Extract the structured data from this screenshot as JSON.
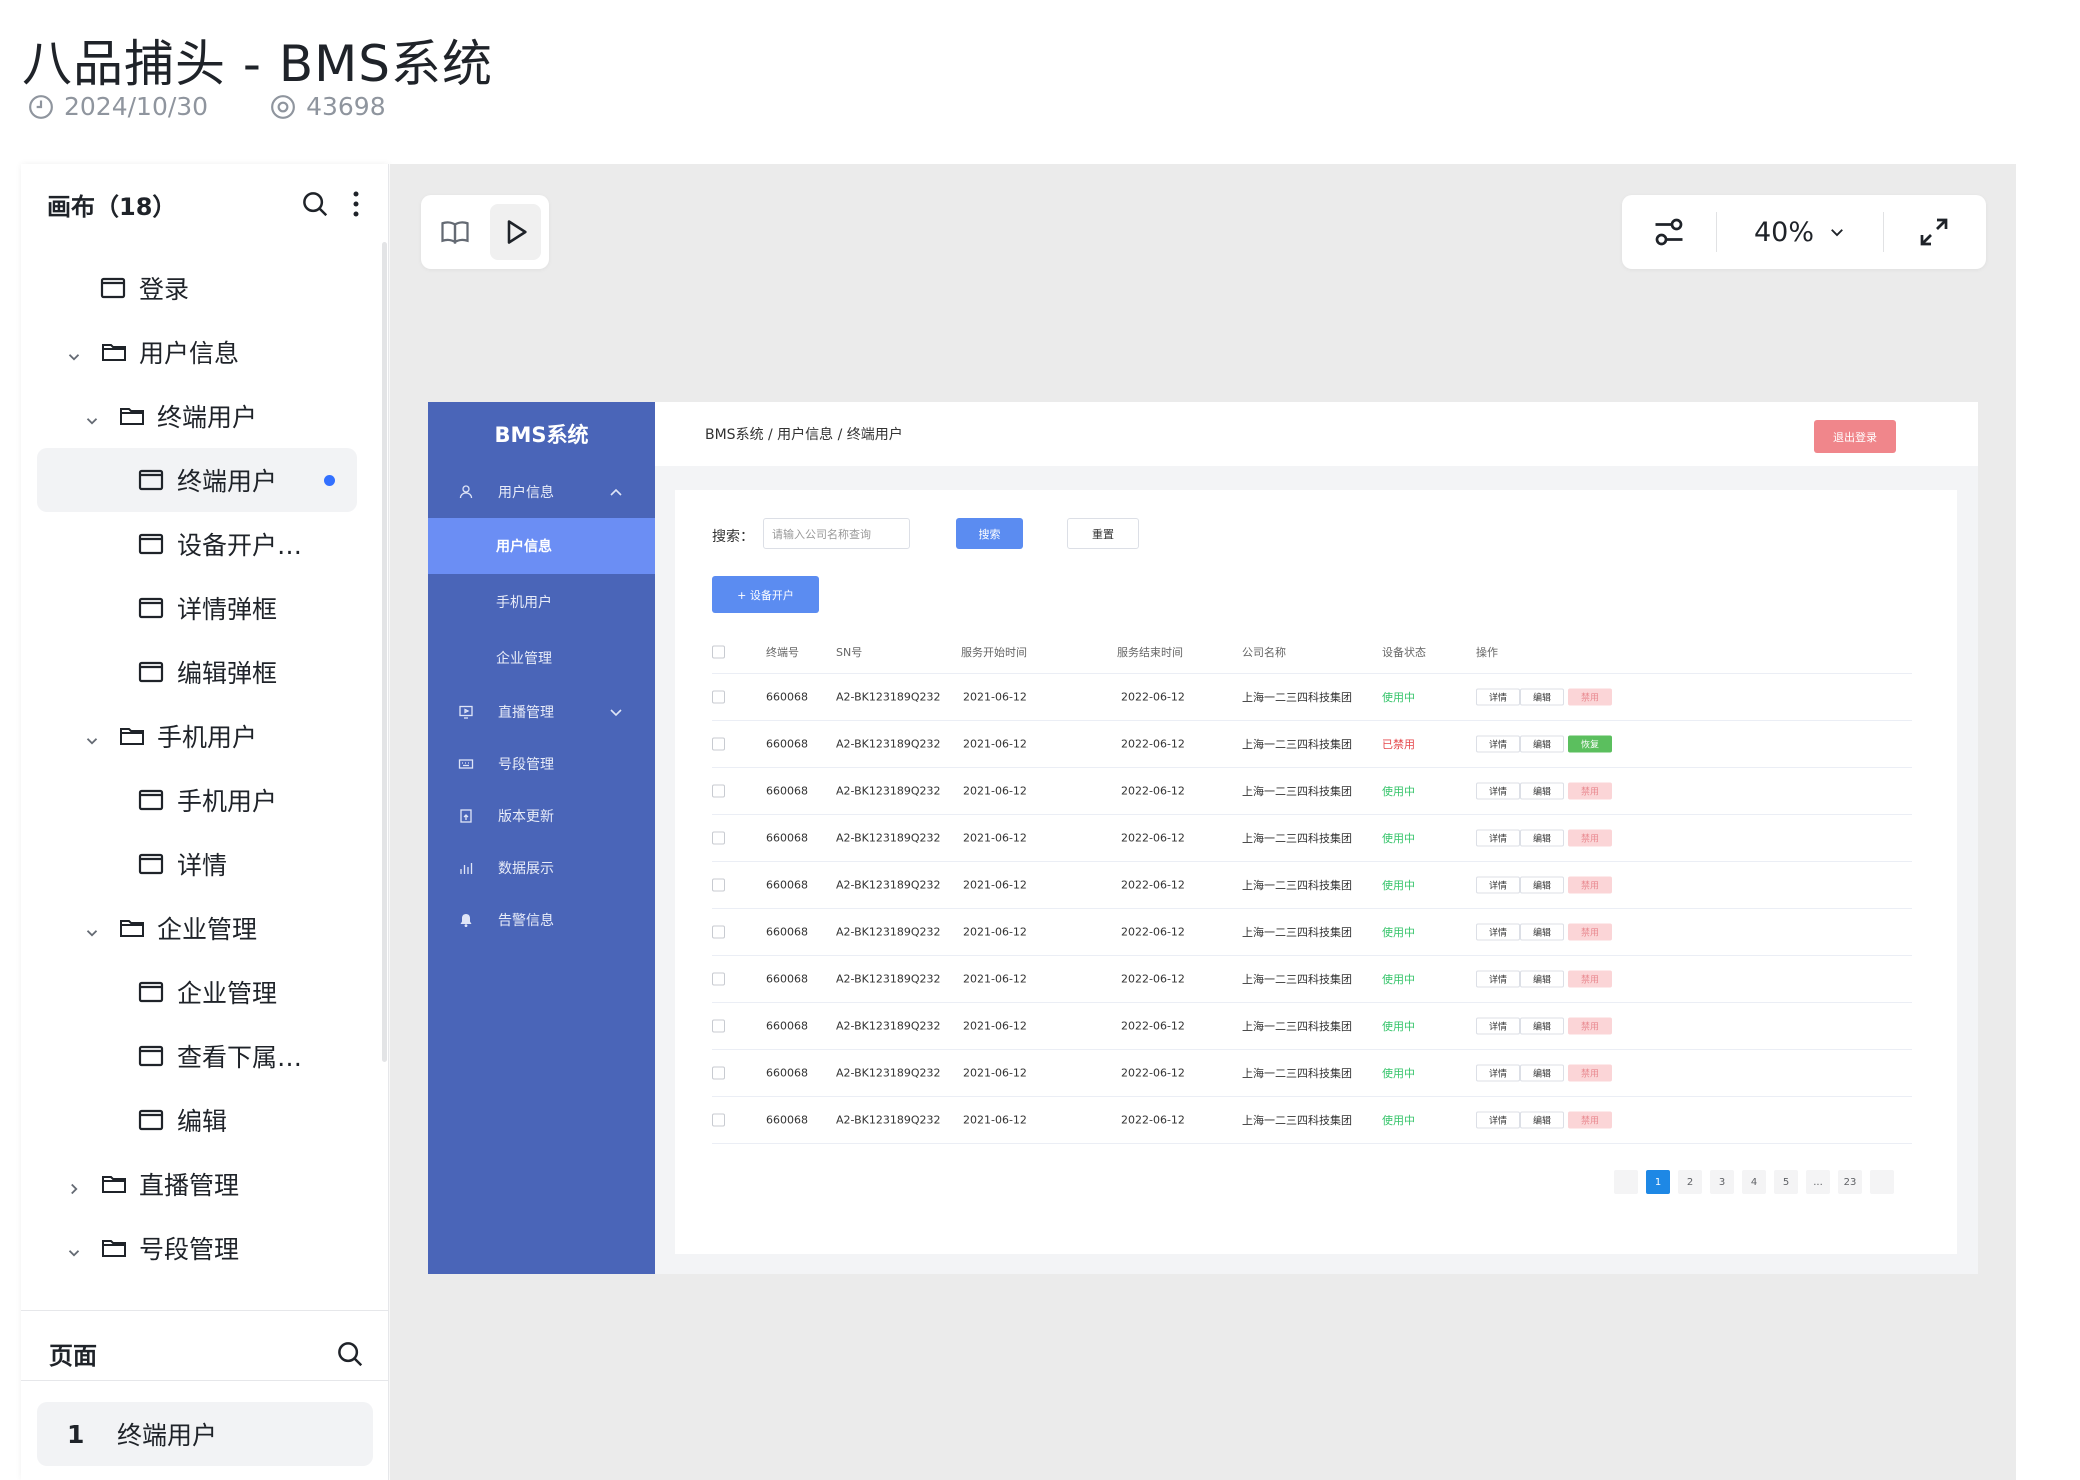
{
  "header": {
    "title": "八品捕头 - BMS系统",
    "date": "2024/10/30",
    "views": "43698"
  },
  "left_panel": {
    "canvas_label": "画布（18）",
    "tree": [
      {
        "label": "登录",
        "type": "page",
        "level": 1
      },
      {
        "label": "用户信息",
        "type": "folder",
        "level": 1,
        "expanded": true
      },
      {
        "label": "终端用户",
        "type": "folder",
        "level": 2,
        "expanded": true
      },
      {
        "label": "终端用户",
        "type": "page",
        "level": 3,
        "active": true
      },
      {
        "label": "设备开户…",
        "type": "page",
        "level": 3
      },
      {
        "label": "详情弹框",
        "type": "page",
        "level": 3
      },
      {
        "label": "编辑弹框",
        "type": "page",
        "level": 3
      },
      {
        "label": "手机用户",
        "type": "folder",
        "level": 2,
        "expanded": true
      },
      {
        "label": "手机用户",
        "type": "page",
        "level": 3
      },
      {
        "label": "详情",
        "type": "page",
        "level": 3
      },
      {
        "label": "企业管理",
        "type": "folder",
        "level": 2,
        "expanded": true
      },
      {
        "label": "企业管理",
        "type": "page",
        "level": 3
      },
      {
        "label": "查看下属…",
        "type": "page",
        "level": 3
      },
      {
        "label": "编辑",
        "type": "page",
        "level": 3
      },
      {
        "label": "直播管理",
        "type": "folder",
        "level": 1,
        "expanded": false
      },
      {
        "label": "号段管理",
        "type": "folder",
        "level": 1,
        "expanded": true
      }
    ],
    "pages_label": "页面",
    "page_list": [
      {
        "num": "1",
        "label": "终端用户"
      }
    ]
  },
  "toolbar": {
    "zoom": "40%"
  },
  "artboard": {
    "brand": "BMS系统",
    "sidebar_menus": [
      {
        "label": "用户信息",
        "icon": "user-icon",
        "arrow": "up"
      },
      {
        "label": "用户信息",
        "sub": true,
        "selected": true
      },
      {
        "label": "手机用户",
        "sub": true
      },
      {
        "label": "企业管理",
        "sub": true
      },
      {
        "label": "直播管理",
        "icon": "monitor-icon",
        "arrow": "down"
      },
      {
        "label": "号段管理",
        "icon": "keyboard-icon"
      },
      {
        "label": "版本更新",
        "icon": "update-icon"
      },
      {
        "label": "数据展示",
        "icon": "bar-chart-icon"
      },
      {
        "label": "告警信息",
        "icon": "bell-icon"
      }
    ],
    "breadcrumb": "BMS系统 / 用户信息 / 终端用户",
    "logout": "退出登录",
    "search_label": "搜索：",
    "search_placeholder": "请输入公司名称查询",
    "search_btn": "搜索",
    "reset_btn": "重置",
    "open_btn": "+ 设备开户",
    "columns": [
      "终端号",
      "SN号",
      "服务开始时间",
      "服务结束时间",
      "公司名称",
      "设备状态",
      "操作"
    ],
    "rows": [
      {
        "id": "660068",
        "sn": "A2-BK123189Q232",
        "start": "2021-06-12",
        "end": "2022-06-12",
        "company": "上海一二三四科技集团",
        "status": "使用中",
        "action3": "禁用"
      },
      {
        "id": "660068",
        "sn": "A2-BK123189Q232",
        "start": "2021-06-12",
        "end": "2022-06-12",
        "company": "上海一二三四科技集团",
        "status": "已禁用",
        "action3": "恢复"
      },
      {
        "id": "660068",
        "sn": "A2-BK123189Q232",
        "start": "2021-06-12",
        "end": "2022-06-12",
        "company": "上海一二三四科技集团",
        "status": "使用中",
        "action3": "禁用"
      },
      {
        "id": "660068",
        "sn": "A2-BK123189Q232",
        "start": "2021-06-12",
        "end": "2022-06-12",
        "company": "上海一二三四科技集团",
        "status": "使用中",
        "action3": "禁用"
      },
      {
        "id": "660068",
        "sn": "A2-BK123189Q232",
        "start": "2021-06-12",
        "end": "2022-06-12",
        "company": "上海一二三四科技集团",
        "status": "使用中",
        "action3": "禁用"
      },
      {
        "id": "660068",
        "sn": "A2-BK123189Q232",
        "start": "2021-06-12",
        "end": "2022-06-12",
        "company": "上海一二三四科技集团",
        "status": "使用中",
        "action3": "禁用"
      },
      {
        "id": "660068",
        "sn": "A2-BK123189Q232",
        "start": "2021-06-12",
        "end": "2022-06-12",
        "company": "上海一二三四科技集团",
        "status": "使用中",
        "action3": "禁用"
      },
      {
        "id": "660068",
        "sn": "A2-BK123189Q232",
        "start": "2021-06-12",
        "end": "2022-06-12",
        "company": "上海一二三四科技集团",
        "status": "使用中",
        "action3": "禁用"
      },
      {
        "id": "660068",
        "sn": "A2-BK123189Q232",
        "start": "2021-06-12",
        "end": "2022-06-12",
        "company": "上海一二三四科技集团",
        "status": "使用中",
        "action3": "禁用"
      },
      {
        "id": "660068",
        "sn": "A2-BK123189Q232",
        "start": "2021-06-12",
        "end": "2022-06-12",
        "company": "上海一二三四科技集团",
        "status": "使用中",
        "action3": "禁用"
      }
    ],
    "action_detail": "详情",
    "action_edit": "编辑",
    "pager": [
      "1",
      "2",
      "3",
      "4",
      "5",
      "...",
      "23"
    ],
    "pager_current": "1"
  }
}
